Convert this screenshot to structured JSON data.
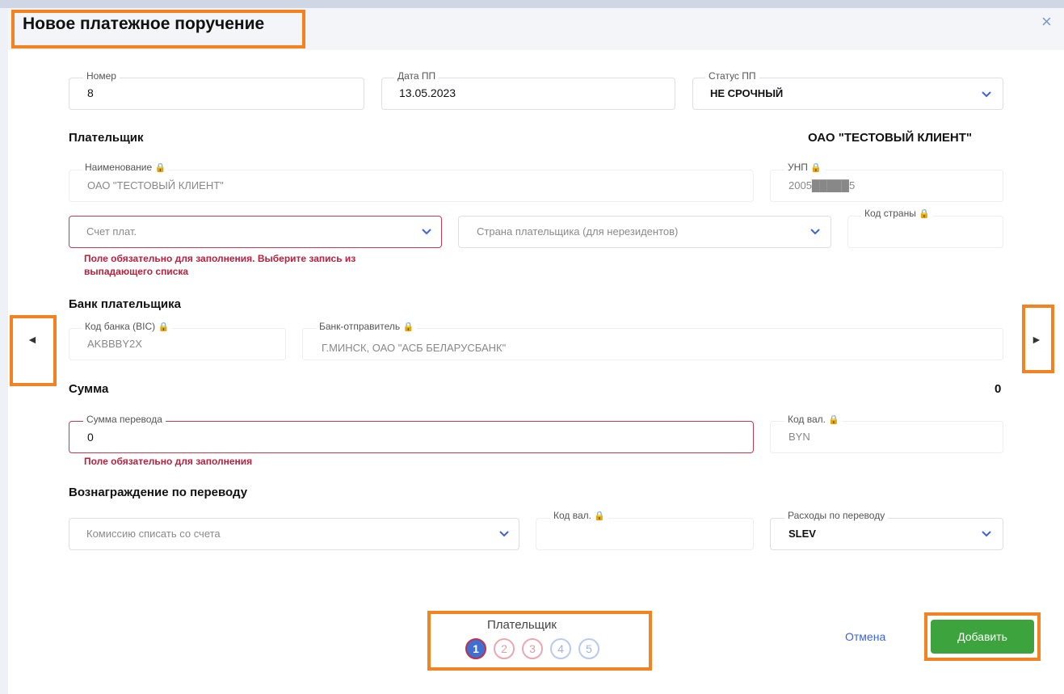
{
  "dialog": {
    "title": "Новое платежное поручение",
    "close_glyph": "×"
  },
  "fields": {
    "number": {
      "label": "Номер",
      "value": "8"
    },
    "date": {
      "label": "Дата ПП",
      "value": "13.05.2023"
    },
    "status": {
      "label": "Статус ПП",
      "value": "НЕ СРОЧНЫЙ"
    }
  },
  "payer": {
    "section_title": "Плательщик",
    "name_right": "ОАО \"ТЕСТОВЫЙ КЛИЕНТ\"",
    "name": {
      "label": "Наименование",
      "value": "ОАО \"ТЕСТОВЫЙ КЛИЕНТ\""
    },
    "unp": {
      "label": "УНП",
      "value": "2005█████5"
    },
    "account": {
      "placeholder": "Счет плат.",
      "error": "Поле обязательно для заполнения. Выберите запись из выпадающего списка"
    },
    "country": {
      "placeholder": "Страна плательщика (для нерезидентов)"
    },
    "country_code": {
      "label": "Код страны",
      "value": ""
    }
  },
  "payer_bank": {
    "section_title": "Банк плательщика",
    "bic": {
      "label": "Код банка (BIC)",
      "value": "AKBBBY2X"
    },
    "sender_bank": {
      "label": "Банк-отправитель",
      "value": "Г.МИНСК, ОАО \"АСБ БЕЛАРУСБАНК\""
    }
  },
  "amount": {
    "section_title": "Сумма",
    "total_right": "0",
    "transfer": {
      "label": "Сумма перевода",
      "value": "0",
      "error": "Поле обязательно для заполнения"
    },
    "currency": {
      "label": "Код вал.",
      "value": "BYN"
    }
  },
  "fee": {
    "section_title": "Вознаграждение по переводу",
    "account": {
      "placeholder": "Комиссию списать со счета"
    },
    "currency": {
      "label": "Код вал.",
      "value": ""
    },
    "expenses": {
      "label": "Расходы по переводу",
      "value": "SLEV"
    }
  },
  "nav": {
    "prev_glyph": "◄",
    "next_glyph": "►"
  },
  "stepper": {
    "current_label": "Плательщик",
    "steps": [
      "1",
      "2",
      "3",
      "4",
      "5"
    ],
    "current_step": 1
  },
  "actions": {
    "cancel": "Отмена",
    "add": "Добавить"
  },
  "icons": {
    "lock": "lock-icon",
    "chevron": "chevron-down-icon",
    "close": "close-icon"
  },
  "colors": {
    "accent": "#3b64d6",
    "error": "#b8203e",
    "success_button": "#3da33d",
    "highlight": "#f58220"
  }
}
